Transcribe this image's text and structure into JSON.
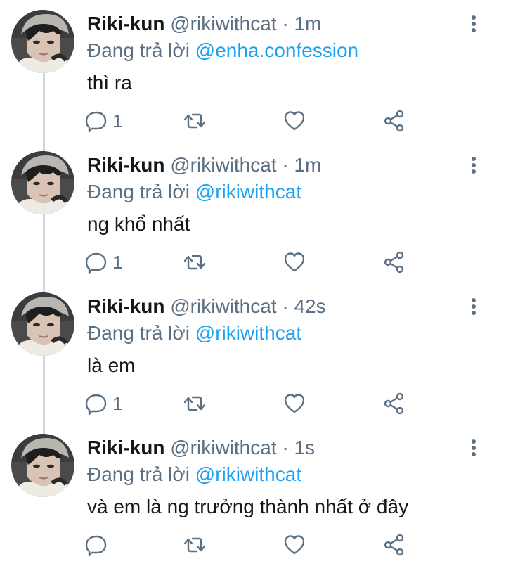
{
  "colors": {
    "text": "#14171a",
    "secondary": "#5b7083",
    "mention": "#1da1f2",
    "thread_line": "#ccd6dd"
  },
  "tweets": [
    {
      "name": "Riki-kun",
      "handle": "@rikiwithcat",
      "separator": "·",
      "time": "1m",
      "reply_prefix": "Đang trả lời",
      "reply_to": "@enha.confession",
      "text": "thì ra",
      "reply_count": "1",
      "icons": [
        "avatar",
        "more-vertical-icon",
        "reply-icon",
        "retweet-icon",
        "like-icon",
        "share-icon"
      ]
    },
    {
      "name": "Riki-kun",
      "handle": "@rikiwithcat",
      "separator": "·",
      "time": "1m",
      "reply_prefix": "Đang trả lời",
      "reply_to": "@rikiwithcat",
      "text": "ng khổ nhất",
      "reply_count": "1",
      "icons": [
        "avatar",
        "more-vertical-icon",
        "reply-icon",
        "retweet-icon",
        "like-icon",
        "share-icon"
      ]
    },
    {
      "name": "Riki-kun",
      "handle": "@rikiwithcat",
      "separator": "·",
      "time": "42s",
      "reply_prefix": "Đang trả lời",
      "reply_to": "@rikiwithcat",
      "text": "là em",
      "reply_count": "1",
      "icons": [
        "avatar",
        "more-vertical-icon",
        "reply-icon",
        "retweet-icon",
        "like-icon",
        "share-icon"
      ]
    },
    {
      "name": "Riki-kun",
      "handle": "@rikiwithcat",
      "separator": "·",
      "time": "1s",
      "reply_prefix": "Đang trả lời",
      "reply_to": "@rikiwithcat",
      "text": "và em là ng trưởng thành nhất ở đây",
      "reply_count": "",
      "icons": [
        "avatar",
        "more-vertical-icon",
        "reply-icon",
        "retweet-icon",
        "like-icon",
        "share-icon"
      ]
    }
  ]
}
